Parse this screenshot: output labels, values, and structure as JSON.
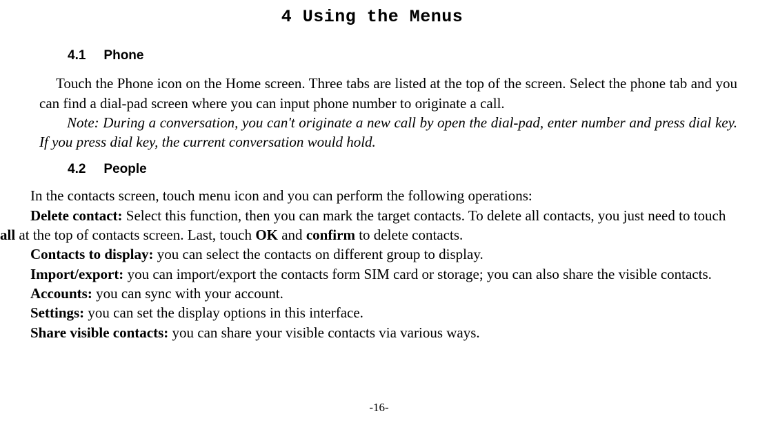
{
  "chapter": {
    "title": "4 Using the Menus"
  },
  "section41": {
    "num": "4.1",
    "title": "Phone",
    "para": "Touch the Phone icon on the Home screen. Three tabs are listed at the top of the screen. Select the phone tab and you can find a dial-pad screen where you can input phone number to originate a call.",
    "note": "Note: During a conversation, you can't originate a new call by open the dial-pad, enter number and press dial key. If you press dial key, the current conversation would hold."
  },
  "section42": {
    "num": "4.2",
    "title": "People",
    "intro": "In the contacts screen, touch menu icon and you can perform the following operations:",
    "delete": {
      "label": "Delete contact:",
      "text1": " Select this function, then you can mark the target contacts. To delete all contacts, you just need to touch ",
      "b_all": "all",
      "text2": " at the top of contacts screen. Last, touch ",
      "b_ok": "OK",
      "text3": " and ",
      "b_confirm": "confirm",
      "text4": " to delete contacts."
    },
    "display": {
      "label": "Contacts to display:",
      "text": " you can select the contacts on different group to display."
    },
    "import": {
      "label": "Import/export:",
      "text": " you can import/export the contacts form SIM card or storage; you can also share the visible contacts."
    },
    "accounts": {
      "label": "Accounts:",
      "text": " you can sync with your account."
    },
    "settings": {
      "label": "Settings:",
      "text": " you can set the display options in this interface."
    },
    "share": {
      "label": "Share visible contacts:",
      "text": " you can share your visible contacts via various ways."
    }
  },
  "pageNumber": "-16-"
}
